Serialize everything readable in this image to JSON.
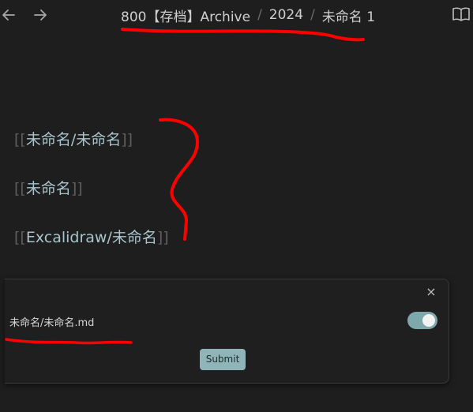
{
  "toolbar": {
    "back_icon": "arrow-left-icon",
    "forward_icon": "arrow-right-icon",
    "reader_icon": "book-open-icon"
  },
  "breadcrumb": {
    "items": [
      "800【存档】Archive",
      "2024",
      "未命名 1"
    ],
    "separator": "/"
  },
  "links": [
    {
      "open": "[[",
      "text": "未命名/未命名",
      "close": "]]"
    },
    {
      "open": "[[",
      "text": "未命名",
      "close": "]]"
    },
    {
      "open": "[[",
      "text": "Excalidraw/未命名",
      "close": "]]"
    }
  ],
  "modal": {
    "close_glyph": "×",
    "file_label": "未命名/未命名.md",
    "toggle_on": true,
    "submit_label": "Submit"
  },
  "colors": {
    "background": "#1e1e1e",
    "link": "#a8c4cc",
    "accent": "#8fb5b9",
    "annotation": "#ff0000"
  }
}
